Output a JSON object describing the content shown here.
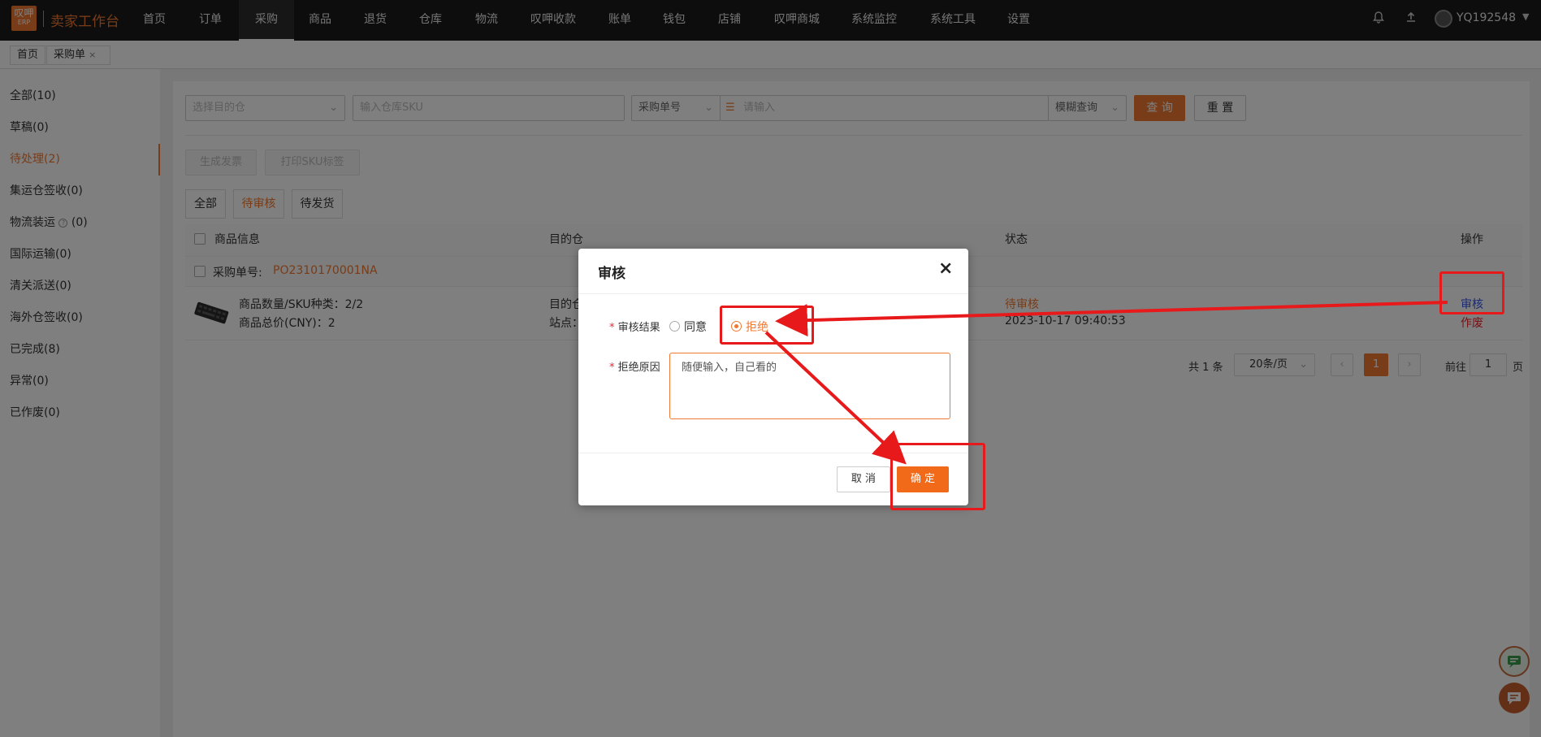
{
  "app": {
    "logo_text": "叹呷",
    "logo_sub": "ERP",
    "title": "卖家工作台"
  },
  "nav": {
    "items": [
      "首页",
      "订单",
      "采购",
      "商品",
      "退货",
      "仓库",
      "物流",
      "叹呷收款",
      "账单",
      "钱包",
      "店铺",
      "叹呷商城",
      "系统监控",
      "系统工具",
      "设置"
    ],
    "active": "采购",
    "username": "YQ192548",
    "icons": [
      "bell-icon",
      "upload-icon"
    ]
  },
  "tabs": {
    "home": "首页",
    "current": "采购单",
    "close": "×"
  },
  "sidebar": {
    "items": [
      "全部(10)",
      "草稿(0)",
      "待处理(2)",
      "集运仓签收(0)",
      "物流装运",
      "国际运输(0)",
      "清关派送(0)",
      "海外仓签收(0)",
      "已完成(8)",
      "异常(0)",
      "已作废(0)"
    ],
    "logistics_suffix": "(0)",
    "active_index": 2
  },
  "filters": {
    "warehouse_placeholder": "选择目的仓",
    "sku_placeholder": "输入仓库SKU",
    "order_type": "采购单号",
    "keyword_placeholder": "请输入",
    "match_mode": "模糊查询",
    "search_label": "查 询",
    "reset_label": "重 置"
  },
  "actions": {
    "invoice_label": "生成发票",
    "print_label": "打印SKU标签"
  },
  "subtabs": {
    "items": [
      "全部",
      "待审核",
      "待发货"
    ],
    "active_index": 1
  },
  "table": {
    "headers": {
      "product": "商品信息",
      "warehouse": "目的仓",
      "status": "状态",
      "ops": "操作"
    },
    "order_label": "采购单号:",
    "order_no": "PO2310170001NA",
    "qty_text": "商品数量/SKU种类：2/2",
    "price_text": "商品总价(CNY)：2",
    "warehouse_line1": "目的仓",
    "warehouse_line2": "站点：",
    "status": "待审核",
    "created_at": "2023-10-17 09:40:53",
    "op_review": "审核",
    "op_void": "作废"
  },
  "pagination": {
    "total": "共 1 条",
    "page_size": "20条/页",
    "current_page": "1",
    "goto_label": "前往",
    "goto_value": "1",
    "page_suffix": "页"
  },
  "dialog": {
    "title": "审核",
    "result_label": "审核结果",
    "option_agree": "同意",
    "option_reject": "拒绝",
    "selected": "拒绝",
    "reason_label": "拒绝原因",
    "reason_value": "随便输入，自己看的",
    "required_mark": "*",
    "cancel_label": "取 消",
    "confirm_label": "确 定",
    "close": "×"
  },
  "colors": {
    "accent": "#f07830",
    "annotation": "#e8191a",
    "link_blue": "#2f54eb",
    "void_red": "#f5222d"
  }
}
